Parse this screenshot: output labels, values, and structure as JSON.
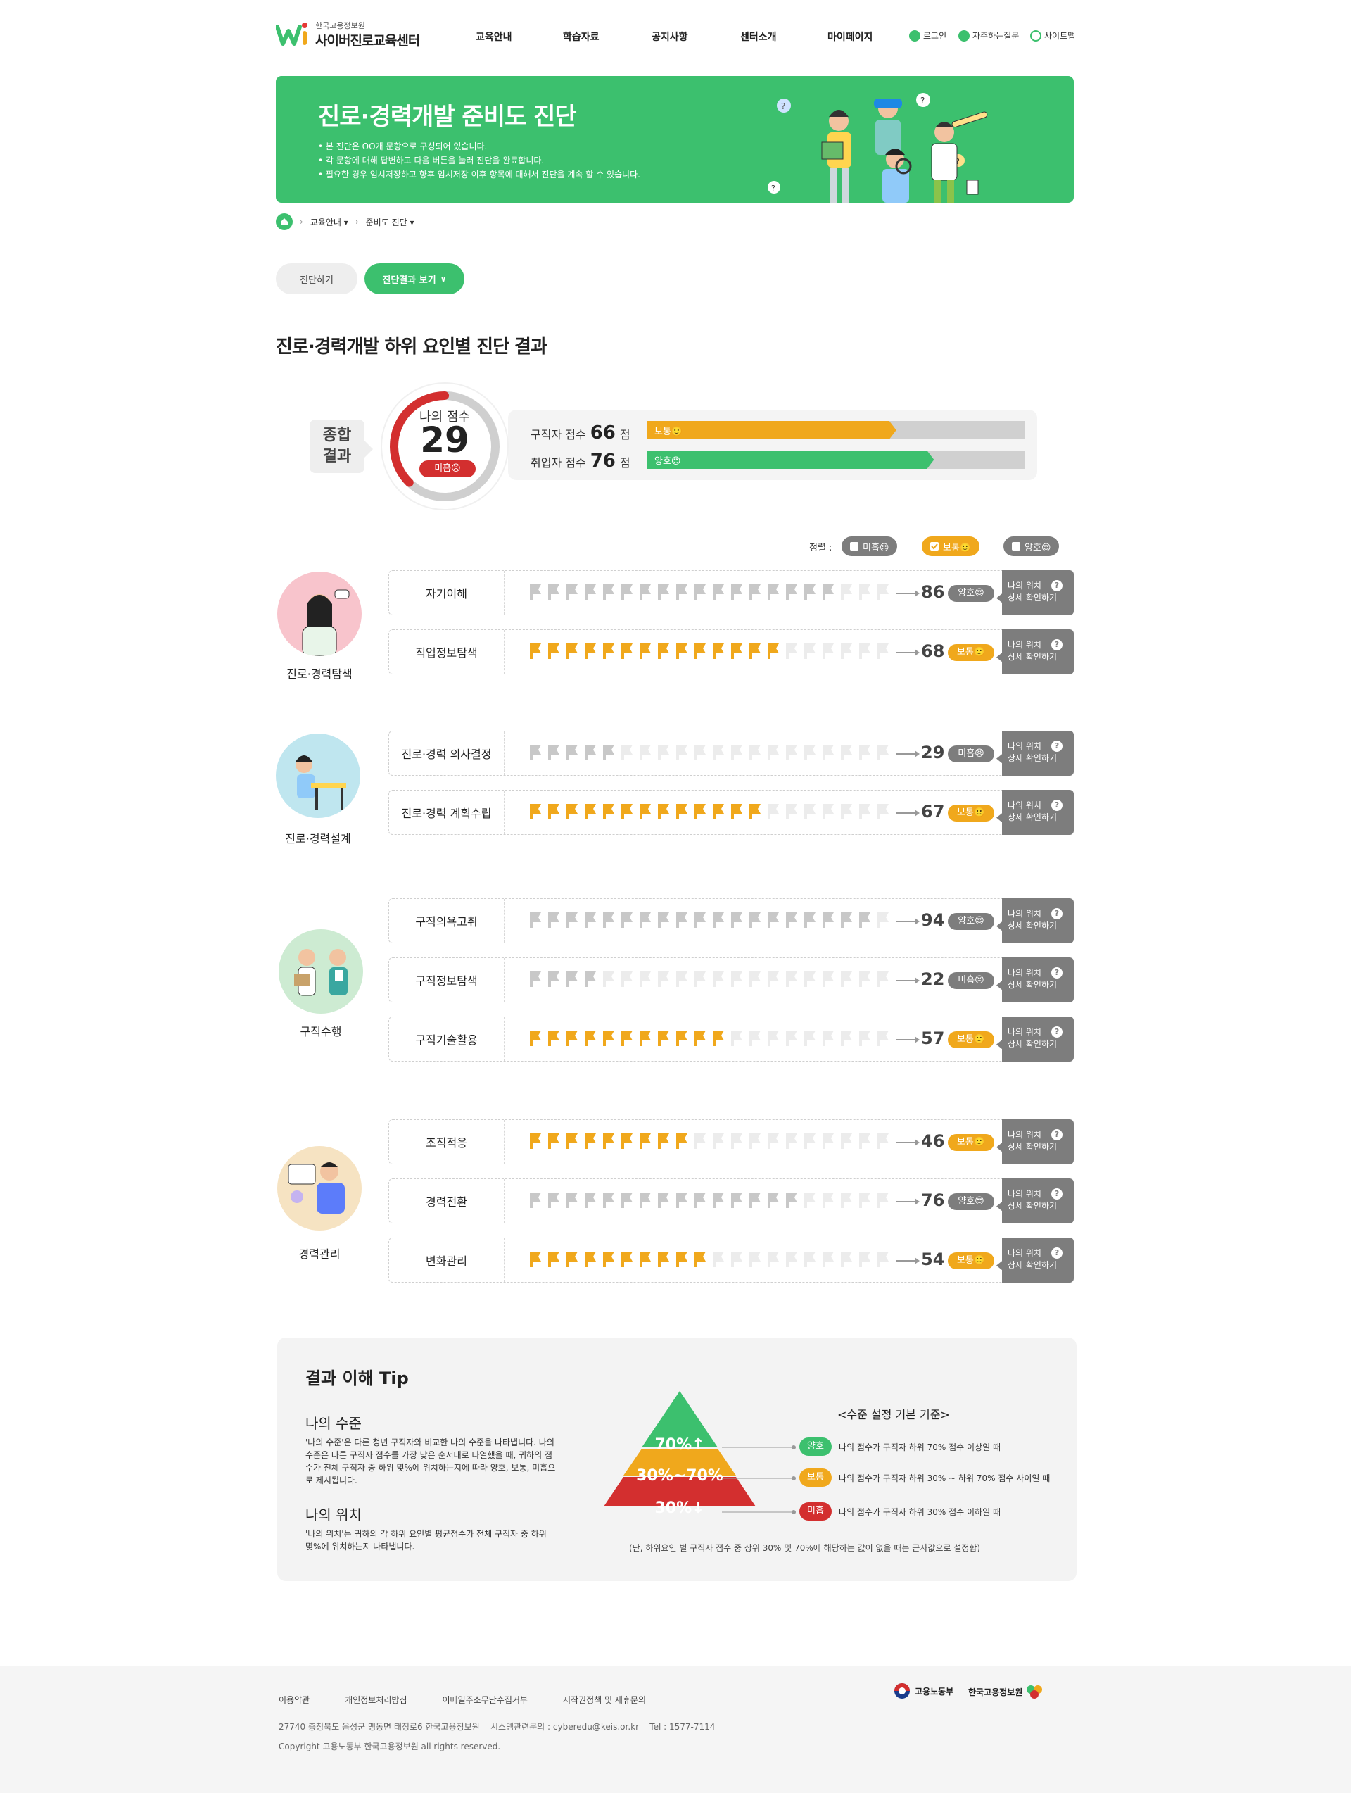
{
  "header": {
    "logo_sub": "한국고용정보원",
    "logo_main": "사이버진로교육센터",
    "nav": [
      "교육안내",
      "학습자료",
      "공지사항",
      "센터소개",
      "마이페이지"
    ],
    "util": {
      "login": "로그인",
      "faq": "자주하는질문",
      "sitemap": "사이트맵"
    }
  },
  "banner": {
    "title": "진로·경력개발 준비도 진단",
    "desc1": "• 본 진단은 OO개 문항으로 구성되어 있습니다.",
    "desc2": "• 각 문항에 대해 답변하고 다음 버튼을 눌러 진단을 완료합니다.",
    "desc3": "• 필요한 경우 임시저장하고 향후 임시저장 이후 항목에 대해서 진단을 계속 할 수 있습니다."
  },
  "breadcrumb": {
    "item1": "교육안내",
    "item2": "준비도 진단"
  },
  "tabs": {
    "diagnose": "진단하기",
    "result": "진단결과 보기"
  },
  "section_title": "진로·경력개발 하위 요인별 진단 결과",
  "summary": {
    "tag": "종합 결과",
    "gauge_label": "나의 점수",
    "score": "29",
    "score_value": 29,
    "grade": "미흡😣",
    "seeker_label": "구직자 점수",
    "seeker_score": "66",
    "seeker_value": 66,
    "seeker_grade": "보통🙂",
    "employee_label": "취업자 점수",
    "employee_score": "76",
    "employee_value": 76,
    "employee_grade": "양호😍",
    "unit": "점"
  },
  "sort": {
    "label": "정렬 :",
    "options": [
      "미흡😣",
      "보통🙂",
      "양호😍"
    ],
    "checked": "보통🙂"
  },
  "colors": {
    "green": "#3cc06e",
    "orange": "#f0a81c",
    "red": "#d32f2f",
    "gray": "#7d7d7d",
    "flag_gray": "#c8c8c8",
    "flag_light": "#ececec"
  },
  "detail_label": {
    "line1": "나의 위치",
    "line2": "상세 확인하기",
    "q": "?"
  },
  "groups": [
    {
      "name": "진로·경력탐색",
      "rows": [
        {
          "name": "자기이해",
          "score": "86",
          "grade": "양호😍",
          "level": "good",
          "flags": 17,
          "highlight": false
        },
        {
          "name": "직업정보탐색",
          "score": "68",
          "grade": "보통🙂",
          "level": "mid",
          "flags": 14,
          "highlight": true
        }
      ]
    },
    {
      "name": "진로·경력설계",
      "rows": [
        {
          "name": "진로·경력 의사결정",
          "score": "29",
          "grade": "미흡😣",
          "level": "bad",
          "flags": 5,
          "highlight": false
        },
        {
          "name": "진로·경력 계획수립",
          "score": "67",
          "grade": "보통🙂",
          "level": "mid",
          "flags": 13,
          "highlight": true
        }
      ]
    },
    {
      "name": "구직수행",
      "rows": [
        {
          "name": "구직의욕고취",
          "score": "94",
          "grade": "양호😍",
          "level": "good",
          "flags": 19,
          "highlight": false
        },
        {
          "name": "구직정보탐색",
          "score": "22",
          "grade": "미흡😣",
          "level": "bad",
          "flags": 4,
          "highlight": false
        },
        {
          "name": "구직기술활용",
          "score": "57",
          "grade": "보통🙂",
          "level": "mid",
          "flags": 11,
          "highlight": true
        }
      ]
    },
    {
      "name": "경력관리",
      "rows": [
        {
          "name": "조직적응",
          "score": "46",
          "grade": "보통🙂",
          "level": "mid",
          "flags": 9,
          "highlight": true
        },
        {
          "name": "경력전환",
          "score": "76",
          "grade": "양호😍",
          "level": "good",
          "flags": 15,
          "highlight": false
        },
        {
          "name": "변화관리",
          "score": "54",
          "grade": "보통🙂",
          "level": "mid",
          "flags": 10,
          "highlight": true
        }
      ]
    }
  ],
  "tip": {
    "title": "결과 이해 Tip",
    "level_title": "나의 수준",
    "level_desc": "'나의 수준'은 다른 청년 구직자와 비교한 나의 수준을 나타냅니다. 나의 수준은 다른 구직자 점수를 가장 낮은 순서대로 나열했을 때, 귀하의 점수가 전체 구직자 중 하위 몇%에 위치하는지에 따라 양호, 보통, 미흡으로 제시됩니다.",
    "pos_title": "나의 위치",
    "pos_desc": "'나의 위치'는 귀하의 각 하위 요인별 평균점수가 전체 구직자 중 하위 몇%에 위치하는지 나타냅니다.",
    "pyramid": {
      "top": "70%↑",
      "mid": "30%~70%",
      "bottom": "30%↓"
    },
    "criteria_title": "<수준 설정 기본 기준>",
    "criteria": [
      {
        "badge": "양호",
        "text": "나의 점수가 구직자 하위 70% 점수 이상일 때"
      },
      {
        "badge": "보통",
        "text": "나의 점수가 구직자 하위 30% ~ 하위 70% 점수 사이일 때"
      },
      {
        "badge": "미흡",
        "text": "나의 점수가 구직자 하위 30% 점수 이하일 때"
      }
    ],
    "note": "(단, 하위요인 별 구직자 점수 중 상위 30% 및 70%에 해당하는 값이 없을 때는 근사값으로 설정함)"
  },
  "footer": {
    "links": [
      "이용약관",
      "개인정보처리방침",
      "이메일주소무단수집거부",
      "저작권정책 및 제휴문의"
    ],
    "address": "27740 충청북도 음성군 맹동면 태정로6 한국고용정보원    시스템관련문의 : cyberedu@keis.or.kr    Tel : 1577-7114",
    "copyright": "Copyright 고용노동부 한국고용정보원 all rights reserved.",
    "logo1": "고용노동부",
    "logo2": "한국고용정보원"
  }
}
